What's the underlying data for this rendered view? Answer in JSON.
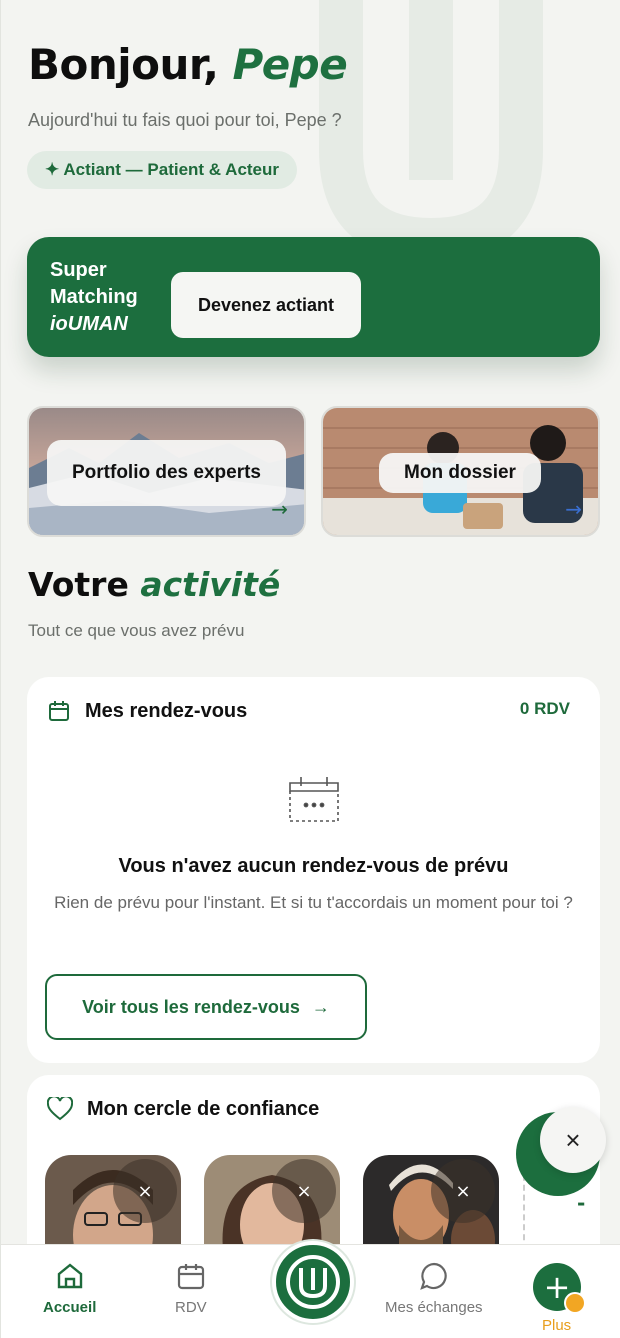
{
  "header": {
    "greeting": "Bonjour,",
    "user_name": "Pepe",
    "subtitle": "Aujourd'hui tu fais quoi pour toi, Pepe ?",
    "role_chip": "✦ Actiant — Patient & Acteur"
  },
  "matching": {
    "line1": "Super",
    "line2": "Matching",
    "brand": "ioUMAN",
    "cta": "Devenez actiant"
  },
  "tiles": {
    "portfolio": "Portfolio des experts",
    "dossier": "Mon dossier"
  },
  "activity": {
    "title_plain": "Votre",
    "title_accent": "activité",
    "subtitle": "Tout ce que vous avez prévu"
  },
  "rdv": {
    "title": "Mes rendez-vous",
    "count": "0 RDV",
    "empty_title": "Vous n'avez aucun rendez-vous de prévu",
    "empty_text": "Rien de prévu pour l'instant. Et si tu t'accordais un moment pour toi ?",
    "cta": "Voir tous les rendez-vous",
    "cta_arrow": "→"
  },
  "cercle": {
    "title": "Mon cercle de confiance",
    "remove": "×",
    "add_slot": "-"
  },
  "fab": {
    "close": "×"
  },
  "nav": {
    "accueil": "Accueil",
    "rdv": "RDV",
    "echanges": "Mes échanges",
    "plus": "Plus",
    "plus_symbol": "+"
  },
  "colors": {
    "brand_green": "#1c6e3e",
    "accent_orange": "#f2a623"
  }
}
